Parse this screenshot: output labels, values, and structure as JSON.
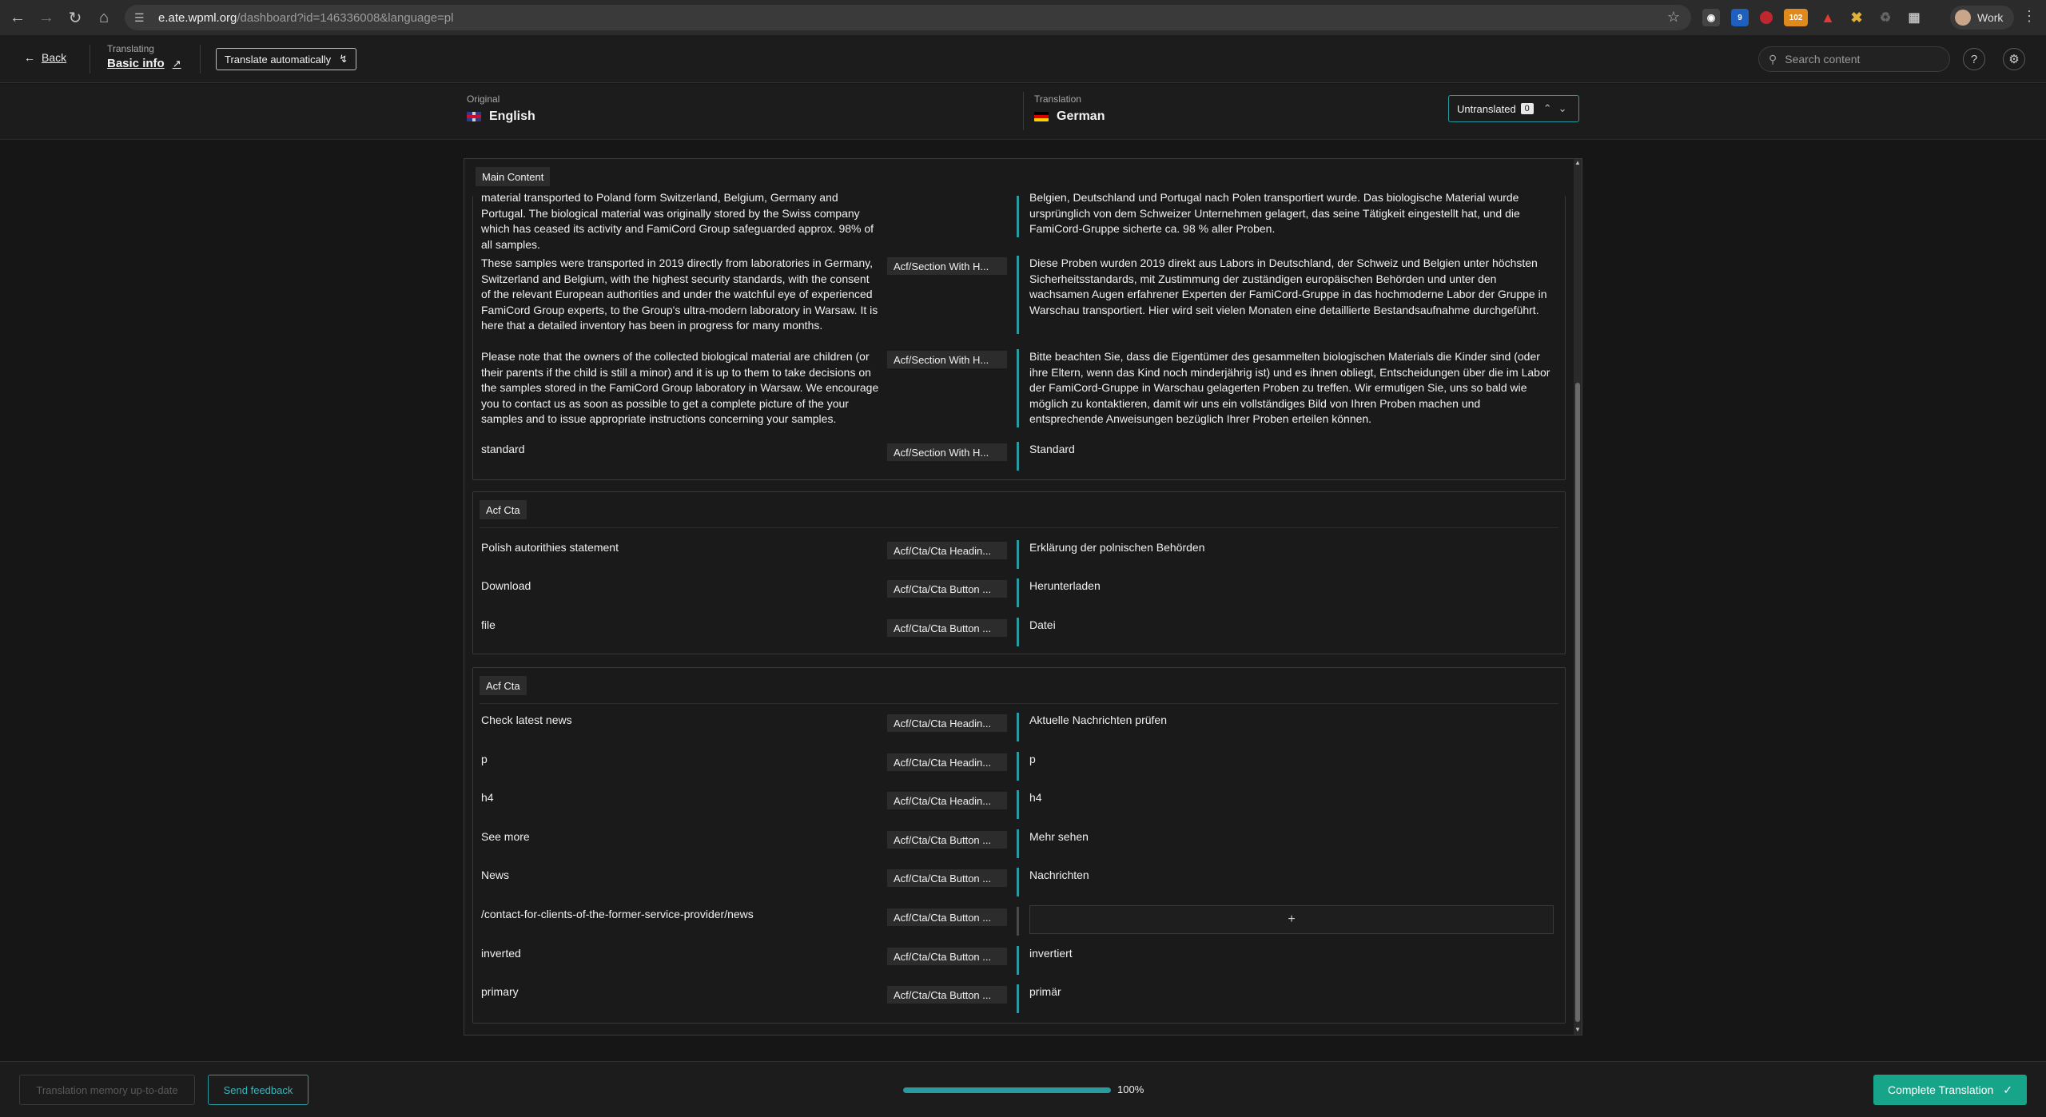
{
  "browser": {
    "url_host": "e.ate.wpml.org",
    "url_path": "/dashboard?id=146336008&language=pl",
    "profile_label": "Work",
    "ext_badge_1": "9",
    "ext_badge_2": "102"
  },
  "header": {
    "back_label": "Back",
    "translating_label": "Translating",
    "document_title": "Basic info",
    "translate_auto_label": "Translate automatically",
    "search_placeholder": "Search content"
  },
  "languages": {
    "original_label": "Original",
    "original_name": "English",
    "translation_label": "Translation",
    "translation_name": "German",
    "filter_label": "Untranslated",
    "filter_count": "0"
  },
  "main_section": {
    "title": "Main Content",
    "rows": [
      {
        "src": "material transported to Poland form Switzerland, Belgium, Germany and Portugal. The biological material was originally stored by the Swiss company which has ceased its activity and FamiCord Group safeguarded approx. 98% of all samples.",
        "tag": "",
        "tgt": "Belgien, Deutschland und Portugal nach Polen transportiert wurde. Das biologische Material wurde ursprünglich von dem Schweizer Unternehmen gelagert, das seine Tätigkeit eingestellt hat, und die FamiCord-Gruppe sicherte ca. 98 % aller Proben."
      },
      {
        "src": "These samples were transported in 2019 directly from laboratories in Germany, Switzerland and Belgium, with the highest security standards, with the consent of the relevant European authorities and under the watchful eye of experienced FamiCord Group experts, to the Group's ultra-modern laboratory in Warsaw. It is here that a detailed inventory has been in progress for many months.",
        "tag": "Acf/Section With H...",
        "tgt": "Diese Proben wurden 2019 direkt aus Labors in Deutschland, der Schweiz und Belgien unter höchsten Sicherheitsstandards, mit Zustimmung der zuständigen europäischen Behörden und unter den wachsamen Augen erfahrener Experten der FamiCord-Gruppe in das hochmoderne Labor der Gruppe in Warschau transportiert. Hier wird seit vielen Monaten eine detaillierte Bestandsaufnahme durchgeführt."
      },
      {
        "src": "Please note that the owners of the collected biological material are children (or their parents if the child is still a minor) and it is up to them to take decisions on the samples stored in the FamiCord Group laboratory in Warsaw. We encourage you to contact us as soon as possible to get a complete picture of the your samples and to issue appropriate instructions concerning your samples.",
        "tag": "Acf/Section With H...",
        "tgt": "Bitte beachten Sie, dass die Eigentümer des gesammelten biologischen Materials die Kinder sind (oder ihre Eltern, wenn das Kind noch minderjährig ist) und es ihnen obliegt, Entscheidungen über die im Labor der FamiCord-Gruppe in Warschau gelagerten Proben zu treffen. Wir ermutigen Sie, uns so bald wie möglich zu kontaktieren, damit wir uns ein vollständiges Bild von Ihren Proben machen und entsprechende Anweisungen bezüglich Ihrer Proben erteilen können."
      },
      {
        "src": "standard",
        "tag": "Acf/Section With H...",
        "tgt": "Standard"
      }
    ]
  },
  "cta_group_1": {
    "title": "Acf Cta",
    "rows": [
      {
        "src": "Polish autorithies statement",
        "tag": "Acf/Cta/Cta Headin...",
        "tgt": "Erklärung der polnischen Behörden"
      },
      {
        "src": "Download",
        "tag": "Acf/Cta/Cta Button ...",
        "tgt": "Herunterladen"
      },
      {
        "src": "file",
        "tag": "Acf/Cta/Cta Button ...",
        "tgt": "Datei"
      }
    ]
  },
  "cta_group_2": {
    "title": "Acf Cta",
    "rows": [
      {
        "src": "Check latest news",
        "tag": "Acf/Cta/Cta Headin...",
        "tgt": "Aktuelle Nachrichten prüfen"
      },
      {
        "src": "p",
        "tag": "Acf/Cta/Cta Headin...",
        "tgt": "p"
      },
      {
        "src": "h4",
        "tag": "Acf/Cta/Cta Headin...",
        "tgt": "h4"
      },
      {
        "src": "See more",
        "tag": "Acf/Cta/Cta Button ...",
        "tgt": "Mehr sehen"
      },
      {
        "src": "News",
        "tag": "Acf/Cta/Cta Button ...",
        "tgt": "Nachrichten"
      },
      {
        "src": "/contact-for-clients-of-the-former-service-provider/news",
        "tag": "Acf/Cta/Cta Button ...",
        "tgt": "+"
      },
      {
        "src": "inverted",
        "tag": "Acf/Cta/Cta Button ...",
        "tgt": "invertiert"
      },
      {
        "src": "primary",
        "tag": "Acf/Cta/Cta Button ...",
        "tgt": "primär"
      }
    ]
  },
  "footer": {
    "tm_label": "Translation memory up-to-date",
    "feedback_label": "Send feedback",
    "progress_percent": 100,
    "progress_label": "100%",
    "complete_label": "Complete Translation"
  },
  "colors": {
    "accent": "#2a9aa0",
    "complete_button": "#17a589"
  }
}
